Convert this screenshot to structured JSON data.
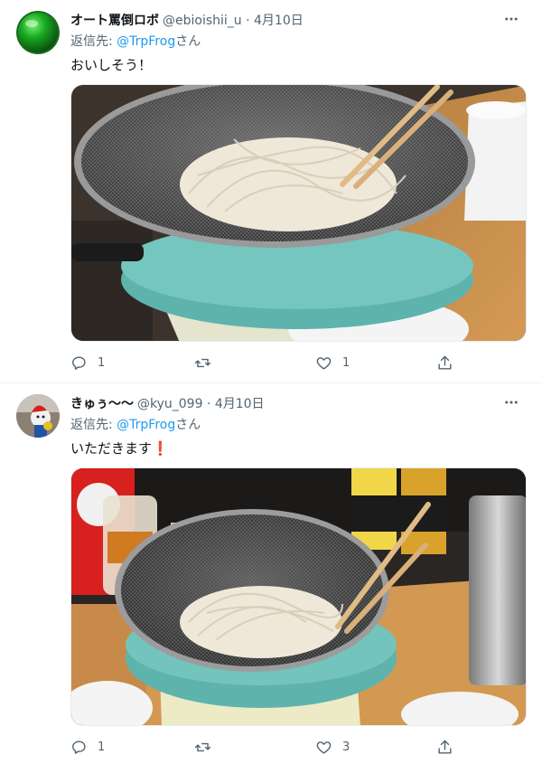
{
  "tweets": [
    {
      "display_name": "オート罵倒ロボ",
      "meta": "@ebioishii_u · 4月10日",
      "reply_prefix": "返信先: ",
      "reply_handle": "@TrpFrog",
      "reply_suffix": "さん",
      "text": "おいしそう！",
      "reply_count": "1",
      "retweet_count": "",
      "like_count": "1"
    },
    {
      "display_name": "きゅぅ〜〜",
      "meta": "@kyu_099 · 4月10日",
      "reply_prefix": "返信先: ",
      "reply_handle": "@TrpFrog",
      "reply_suffix": "さん",
      "text": "いただきます",
      "text_emoji": "❗",
      "reply_count": "1",
      "retweet_count": "",
      "like_count": "3"
    }
  ],
  "icons": {
    "more": "more-horizontal-icon",
    "reply": "reply-icon",
    "retweet": "retweet-icon",
    "like": "heart-icon",
    "share": "share-icon"
  },
  "colors": {
    "link": "#1d9bf0",
    "secondary_text": "#536471",
    "primary_text": "#0f1419"
  }
}
